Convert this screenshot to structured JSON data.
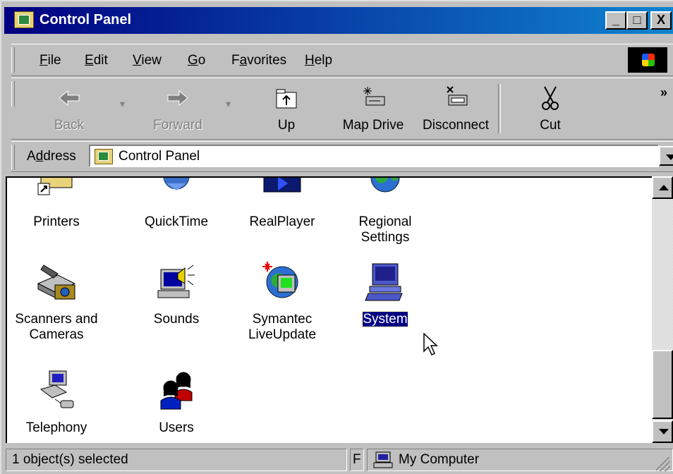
{
  "window": {
    "title": "Control Panel"
  },
  "title_buttons": [
    "_",
    "□",
    "X"
  ],
  "menu": [
    {
      "label": "File",
      "ul": "F",
      "rest": "ile"
    },
    {
      "label": "Edit",
      "ul": "E",
      "rest": "dit"
    },
    {
      "label": "View",
      "ul": "V",
      "rest": "iew"
    },
    {
      "label": "Go",
      "ul": "G",
      "rest": "o"
    },
    {
      "label": "Favorites",
      "pre": "F",
      "ul": "a",
      "rest": "vorites"
    },
    {
      "label": "Help",
      "ul": "H",
      "rest": "elp"
    }
  ],
  "toolbar": {
    "back": "Back",
    "forward": "Forward",
    "up": "Up",
    "map_drive": "Map Drive",
    "disconnect": "Disconnect",
    "cut": "Cut",
    "more": "»"
  },
  "address": {
    "label_pre": "A",
    "label_ul": "d",
    "label_rest": "dress",
    "value": "Control Panel"
  },
  "icons": [
    {
      "line1": "Printers",
      "line2": ""
    },
    {
      "line1": "QuickTime",
      "line2": ""
    },
    {
      "line1": "RealPlayer",
      "line2": ""
    },
    {
      "line1": "Regional",
      "line2": "Settings"
    },
    {
      "line1": "Scanners and",
      "line2": "Cameras"
    },
    {
      "line1": "Sounds",
      "line2": ""
    },
    {
      "line1": "Symantec",
      "line2": "LiveUpdate"
    },
    {
      "line1": "System",
      "line2": ""
    },
    {
      "line1": "Telephony",
      "line2": ""
    },
    {
      "line1": "Users",
      "line2": ""
    }
  ],
  "status": {
    "selection": "1 object(s) selected",
    "mid": "F",
    "location": "My Computer"
  },
  "colors": {
    "titlebar": "#000080",
    "selection": "#000080",
    "face": "#c0c0c0"
  }
}
